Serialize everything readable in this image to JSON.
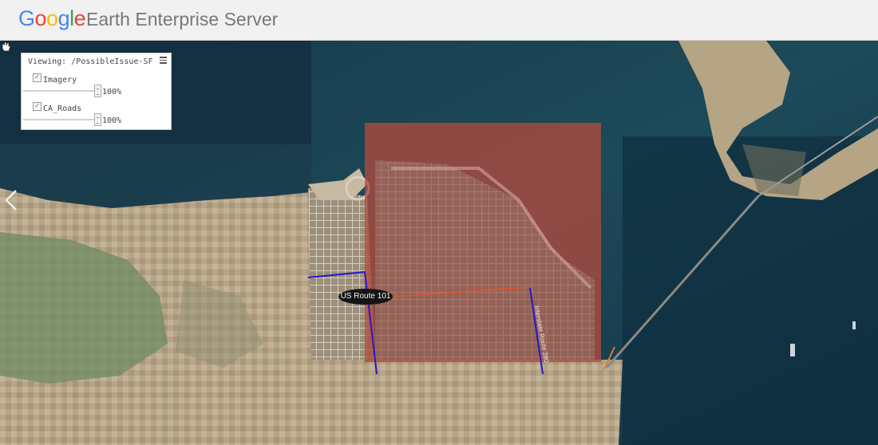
{
  "header": {
    "logo": {
      "letters": [
        {
          "char": "G",
          "color": "#4285f4"
        },
        {
          "char": "o",
          "color": "#ea4335"
        },
        {
          "char": "o",
          "color": "#fbbc05"
        },
        {
          "char": "g",
          "color": "#4285f4"
        },
        {
          "char": "l",
          "color": "#34a853"
        },
        {
          "char": "e",
          "color": "#ea4335"
        }
      ]
    },
    "title": "Earth Enterprise Server"
  },
  "layer_panel": {
    "viewing_label": "Viewing: /PossibleIssue-SF",
    "menu_icon": "hamburger-menu-icon",
    "layers": [
      {
        "name": "Imagery",
        "checked": true,
        "opacity": "100%"
      },
      {
        "name": "CA_Roads",
        "checked": true,
        "opacity": "100%"
      }
    ]
  },
  "map": {
    "nav_icon": "chevron-left-icon",
    "cursor_icon": "grab-hand-icon",
    "overlay_color": "#b04a3e",
    "road_labels": {
      "route_101": "US Route 101",
      "route_vertical": "Interstate Route 280"
    },
    "road_colors": {
      "primary": "#2318c8",
      "secondary": "#e5552d"
    }
  }
}
